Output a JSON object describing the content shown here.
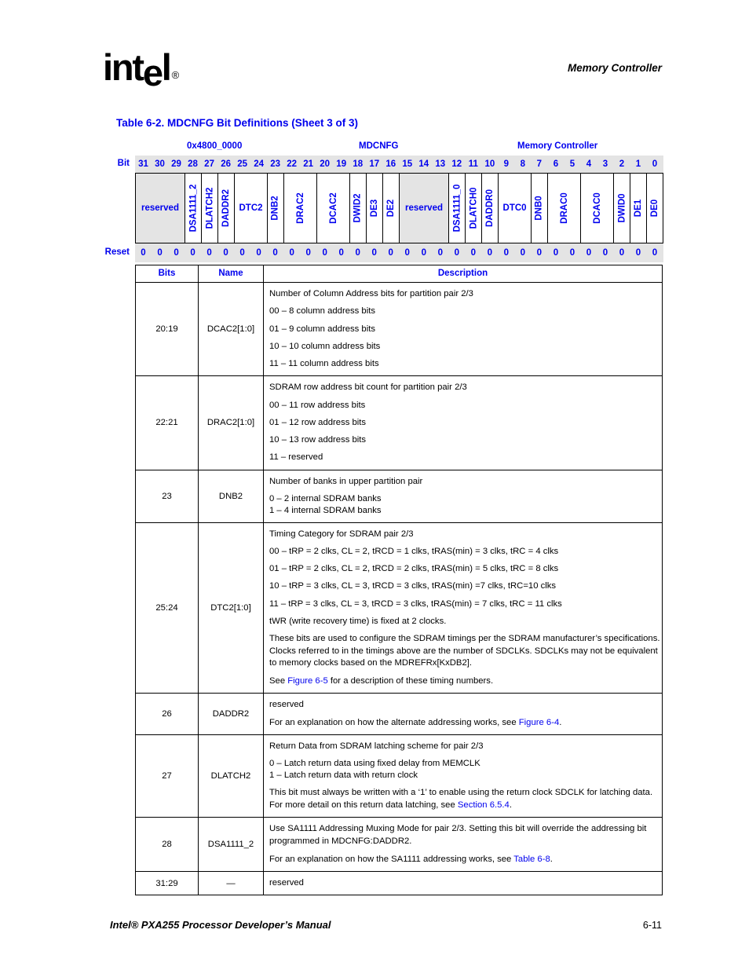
{
  "header": {
    "logo_text": "intel",
    "logo_registered": "®",
    "chapter_title": "Memory Controller"
  },
  "table_title": "Table 6-2. MDCNFG Bit Definitions (Sheet 3 of 3)",
  "register": {
    "address": "0x4800_0000",
    "name": "MDCNFG",
    "unit": "Memory Controller",
    "bit_label": "Bit",
    "reset_label": "Reset",
    "bit_numbers": [
      "31",
      "30",
      "29",
      "28",
      "27",
      "26",
      "25",
      "24",
      "23",
      "22",
      "21",
      "20",
      "19",
      "18",
      "17",
      "16",
      "15",
      "14",
      "13",
      "12",
      "11",
      "10",
      "9",
      "8",
      "7",
      "6",
      "5",
      "4",
      "3",
      "2",
      "1",
      "0"
    ],
    "reset_values": [
      "0",
      "0",
      "0",
      "0",
      "0",
      "0",
      "0",
      "0",
      "0",
      "0",
      "0",
      "0",
      "0",
      "0",
      "0",
      "0",
      "0",
      "0",
      "0",
      "0",
      "0",
      "0",
      "0",
      "0",
      "0",
      "0",
      "0",
      "0",
      "0",
      "0",
      "0",
      "0"
    ],
    "fields": [
      {
        "label": "reserved",
        "bits": 3,
        "orientation": "horizontal",
        "shaded": true
      },
      {
        "label": "DSA1111_2",
        "bits": 1,
        "orientation": "vertical",
        "shaded": false
      },
      {
        "label": "DLATCH2",
        "bits": 1,
        "orientation": "vertical",
        "shaded": false
      },
      {
        "label": "DADDR2",
        "bits": 1,
        "orientation": "vertical",
        "shaded": false
      },
      {
        "label": "DTC2",
        "bits": 2,
        "orientation": "horizontal",
        "shaded": false
      },
      {
        "label": "DNB2",
        "bits": 1,
        "orientation": "vertical",
        "shaded": false
      },
      {
        "label": "DRAC2",
        "bits": 2,
        "orientation": "vertical",
        "shaded": false
      },
      {
        "label": "DCAC2",
        "bits": 2,
        "orientation": "vertical",
        "shaded": false
      },
      {
        "label": "DWID2",
        "bits": 1,
        "orientation": "vertical",
        "shaded": false
      },
      {
        "label": "DE3",
        "bits": 1,
        "orientation": "vertical",
        "shaded": false
      },
      {
        "label": "DE2",
        "bits": 1,
        "orientation": "vertical",
        "shaded": false
      },
      {
        "label": "reserved",
        "bits": 3,
        "orientation": "horizontal",
        "shaded": true
      },
      {
        "label": "DSA1111_0",
        "bits": 1,
        "orientation": "vertical",
        "shaded": false
      },
      {
        "label": "DLATCH0",
        "bits": 1,
        "orientation": "vertical",
        "shaded": false
      },
      {
        "label": "DADDR0",
        "bits": 1,
        "orientation": "vertical",
        "shaded": false
      },
      {
        "label": "DTC0",
        "bits": 2,
        "orientation": "horizontal",
        "shaded": false
      },
      {
        "label": "DNB0",
        "bits": 1,
        "orientation": "vertical",
        "shaded": false
      },
      {
        "label": "DRAC0",
        "bits": 2,
        "orientation": "vertical",
        "shaded": false
      },
      {
        "label": "DCAC0",
        "bits": 2,
        "orientation": "vertical",
        "shaded": false
      },
      {
        "label": "DWID0",
        "bits": 1,
        "orientation": "vertical",
        "shaded": false
      },
      {
        "label": "DE1",
        "bits": 1,
        "orientation": "vertical",
        "shaded": false
      },
      {
        "label": "DE0",
        "bits": 1,
        "orientation": "vertical",
        "shaded": false
      }
    ]
  },
  "desc_table": {
    "columns": [
      "Bits",
      "Name",
      "Description"
    ],
    "rows": [
      {
        "bits": "20:19",
        "name": "DCAC2[1:0]",
        "description": [
          {
            "type": "line",
            "text": "Number of Column Address bits for partition pair 2/3"
          },
          {
            "type": "line",
            "text": "00 – 8 column address bits"
          },
          {
            "type": "line",
            "text": "01 – 9 column address bits"
          },
          {
            "type": "line",
            "text": "10 – 10 column address bits"
          },
          {
            "type": "line",
            "text": "11 – 11 column address bits"
          }
        ]
      },
      {
        "bits": "22:21",
        "name": "DRAC2[1:0]",
        "description": [
          {
            "type": "line",
            "text": "SDRAM row address bit count for partition pair 2/3"
          },
          {
            "type": "line",
            "text": "00 – 11 row address bits"
          },
          {
            "type": "line",
            "text": "01 – 12 row address bits"
          },
          {
            "type": "line",
            "text": "10 – 13 row address bits"
          },
          {
            "type": "line",
            "text": "11 – reserved"
          }
        ]
      },
      {
        "bits": "23",
        "name": "DNB2",
        "description": [
          {
            "type": "line",
            "text": "Number of banks in upper partition pair"
          },
          {
            "type": "group",
            "lines": [
              "0 –  2 internal SDRAM banks",
              "1 –  4 internal SDRAM banks"
            ]
          }
        ]
      },
      {
        "bits": "25:24",
        "name": "DTC2[1:0]",
        "description": [
          {
            "type": "line",
            "text": "Timing Category for SDRAM pair 2/3"
          },
          {
            "type": "line",
            "text": "00 – tRP = 2 clks, CL = 2, tRCD = 1 clks, tRAS(min) = 3 clks, tRC = 4 clks"
          },
          {
            "type": "line",
            "text": "01 – tRP = 2 clks, CL = 2, tRCD = 2 clks, tRAS(min) = 5 clks, tRC = 8 clks"
          },
          {
            "type": "line",
            "text": "10 – tRP = 3 clks, CL = 3, tRCD = 3 clks, tRAS(min) =7 clks, tRC=10 clks"
          },
          {
            "type": "line",
            "text": "11 – tRP = 3 clks, CL = 3, tRCD = 3 clks, tRAS(min) = 7 clks, tRC = 11 clks"
          },
          {
            "type": "line",
            "text": "tWR (write recovery time) is fixed at 2 clocks."
          },
          {
            "type": "para",
            "text": "These bits are used to configure the SDRAM timings per the SDRAM manufacturer’s specifications. Clocks referred to in the timings above are the number of SDCLKs. SDCLKs may not be equivalent to memory clocks based on the MDREFRx[KxDB2]."
          },
          {
            "type": "link_line",
            "before": "See ",
            "link": "Figure 6-5",
            "after": " for a description of these timing numbers."
          }
        ]
      },
      {
        "bits": "26",
        "name": "DADDR2",
        "description": [
          {
            "type": "line",
            "text": "reserved"
          },
          {
            "type": "link_line",
            "before": "For an explanation on how the alternate addressing works, see ",
            "link": "Figure 6-4",
            "after": "."
          }
        ]
      },
      {
        "bits": "27",
        "name": "DLATCH2",
        "description": [
          {
            "type": "line",
            "text": "Return Data from SDRAM latching scheme for pair 2/3"
          },
          {
            "type": "group",
            "lines": [
              "0 –  Latch return data using fixed delay from MEMCLK",
              "1 –  Latch return data with return clock"
            ]
          },
          {
            "type": "link_line",
            "before": "This bit must always be written with a ‘1’ to enable using the return clock SDCLK for latching data. For more detail on this return data latching, see ",
            "link": "Section 6.5.4",
            "after": "."
          }
        ]
      },
      {
        "bits": "28",
        "name": "DSA1111_2",
        "description": [
          {
            "type": "para",
            "text": "Use SA1111 Addressing Muxing Mode for pair 2/3. Setting this bit will override the addressing bit programmed in MDCNFG:DADDR2."
          },
          {
            "type": "link_line",
            "before": "For an explanation on how the SA1111 addressing works, see ",
            "link": "Table 6-8",
            "after": "."
          }
        ]
      },
      {
        "bits": "31:29",
        "name": "—",
        "description": [
          {
            "type": "line",
            "text": "reserved"
          }
        ]
      }
    ]
  },
  "footer": {
    "manual_title": "Intel® PXA255 Processor Developer’s Manual",
    "page_number": "6-11"
  },
  "colors": {
    "link_blue": "#0000ee",
    "shaded_gray": "#e4e4e4"
  }
}
